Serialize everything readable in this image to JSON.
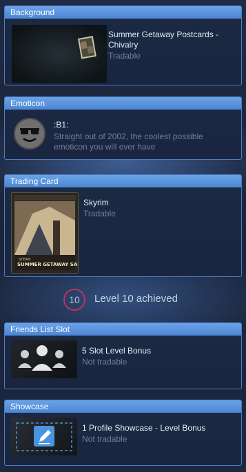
{
  "background": {
    "header": "Background",
    "name": "Summer Getaway Postcards -",
    "name2": "Chivalry",
    "status": "Tradable"
  },
  "emoticon": {
    "header": "Emoticon",
    "code": ":B1:",
    "desc1": "Straight out of 2002, the coolest possible",
    "desc2": "emoticon you will ever have"
  },
  "trading_card": {
    "header": "Trading Card",
    "name": "Skyrim",
    "status": "Tradable",
    "card_brand": "STEAM",
    "card_banner": "SUMMER GETAWAY SALE"
  },
  "level": {
    "number": "10",
    "text": "Level 10 achieved"
  },
  "friends_slot": {
    "header": "Friends List Slot",
    "name": "5 Slot Level Bonus",
    "status": "Not tradable"
  },
  "showcase": {
    "header": "Showcase",
    "name": "1 Profile Showcase - Level Bonus",
    "status": "Not tradable"
  }
}
